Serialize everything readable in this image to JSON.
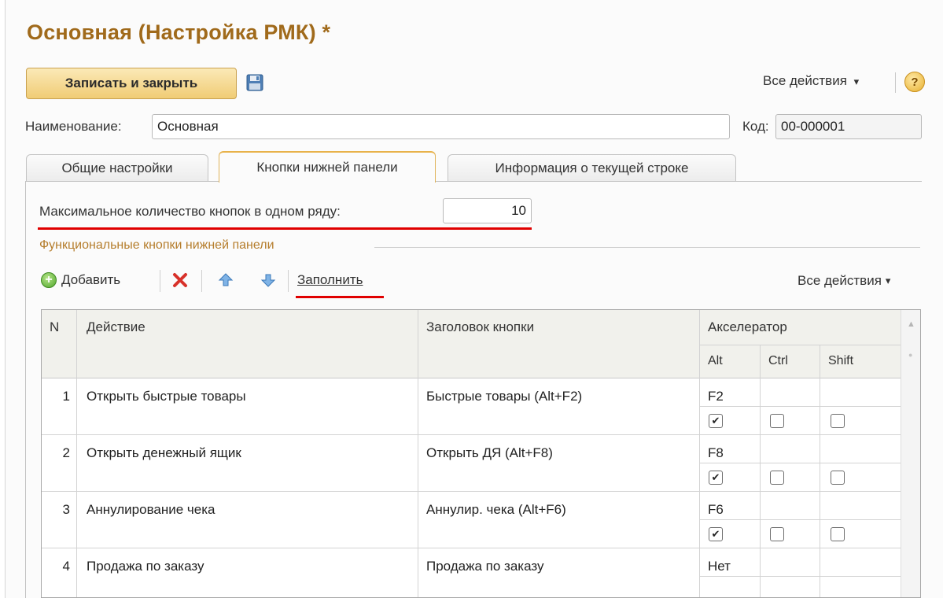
{
  "window": {
    "title": "Основная (Настройка РМК) *"
  },
  "toolbar": {
    "save_close_label": "Записать и закрыть",
    "all_actions_label": "Все действия",
    "dropdown_glyph": "▾",
    "help_glyph": "?"
  },
  "form": {
    "name_label": "Наименование:",
    "name_value": "Основная",
    "code_label": "Код:",
    "code_value": "00-000001"
  },
  "tabs": [
    {
      "label": "Общие настройки",
      "active": false
    },
    {
      "label": "Кнопки нижней панели",
      "active": true
    },
    {
      "label": "Информация о текущей строке",
      "active": false
    }
  ],
  "settings": {
    "max_buttons_label": "Максимальное количество кнопок в одном ряду:",
    "max_buttons_value": "10"
  },
  "group": {
    "title": "Функциональные кнопки нижней панели"
  },
  "table_toolbar": {
    "add_label": "Добавить",
    "fill_label": "Заполнить",
    "all_actions_label": "Все действия",
    "icons": [
      "add-icon",
      "delete-icon",
      "move-up-icon",
      "move-down-icon"
    ]
  },
  "table": {
    "headers": {
      "n": "N",
      "action": "Действие",
      "caption": "Заголовок кнопки",
      "accelerator": "Акселератор",
      "alt": "Alt",
      "ctrl": "Ctrl",
      "shift": "Shift"
    },
    "rows": [
      {
        "n": "1",
        "action": "Открыть быстрые товары",
        "caption": "Быстрые товары (Alt+F2)",
        "key": "F2",
        "alt": true,
        "ctrl": false,
        "shift": false
      },
      {
        "n": "2",
        "action": "Открыть денежный ящик",
        "caption": "Открыть ДЯ (Alt+F8)",
        "key": "F8",
        "alt": true,
        "ctrl": false,
        "shift": false
      },
      {
        "n": "3",
        "action": "Аннулирование чека",
        "caption": "Аннулир. чека (Alt+F6)",
        "key": "F6",
        "alt": true,
        "ctrl": false,
        "shift": false
      },
      {
        "n": "4",
        "action": "Продажа по заказу",
        "caption": "Продажа по заказу",
        "key": "Нет",
        "alt": null,
        "ctrl": null,
        "shift": null
      }
    ]
  },
  "colors": {
    "title": "#a06a1b",
    "accent_button": "#f0cc75",
    "annotation_red": "#e00000",
    "group_title": "#b57d2c"
  }
}
